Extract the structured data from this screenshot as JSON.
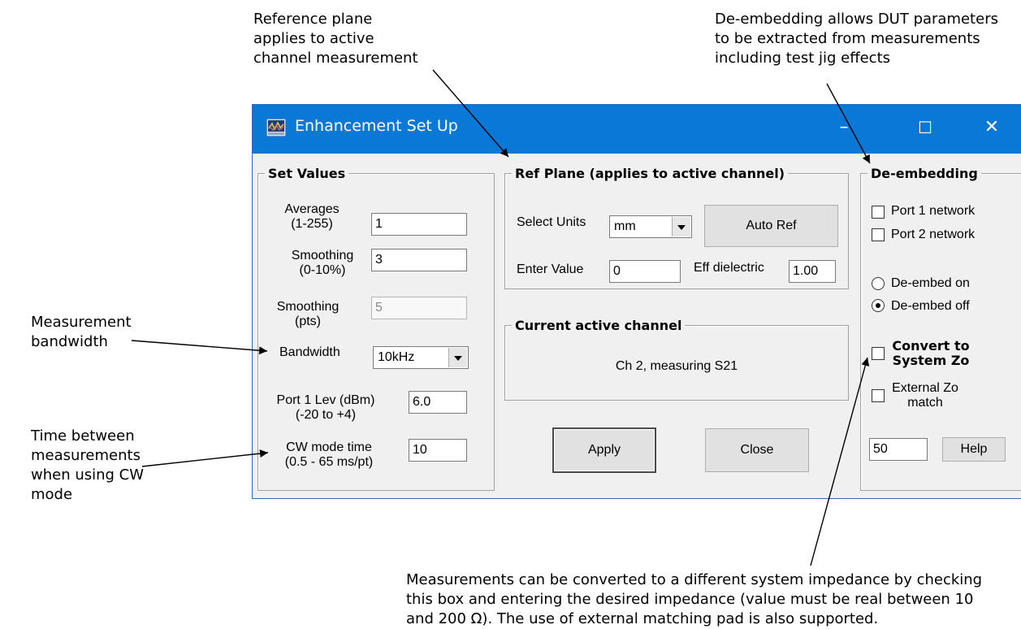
{
  "annotations": {
    "ref_plane": "Reference plane\napplies to active\nchannel measurement",
    "de_embedding": "De-embedding allows DUT parameters\nto be extracted from measurements\nincluding test jig effects",
    "bandwidth": "Measurement\nbandwidth",
    "cw_time": "Time between\nmeasurements\nwhen using CW\nmode",
    "convert": "Measurements can be converted to a different system impedance by checking\nthis box and entering the desired impedance (value must be real between 10\nand 200 Ω). The use of external matching pad is also supported."
  },
  "window": {
    "title": "Enhancement Set Up",
    "minimize": "–",
    "maximize": "☐",
    "close": "✕"
  },
  "set_values": {
    "legend": "Set Values",
    "averages_label": "Averages\n(1-255)",
    "averages_value": "1",
    "smoothing_pct_label": "Smoothing\n(0-10%)",
    "smoothing_pct_value": "3",
    "smoothing_pts_label": "Smoothing\n(pts)",
    "smoothing_pts_value": "5",
    "bandwidth_label": "Bandwidth",
    "bandwidth_value": "10kHz",
    "port1_label": "Port 1 Lev (dBm)\n(-20 to +4)",
    "port1_value": "6.0",
    "cw_label": "CW mode time\n(0.5 - 65 ms/pt)",
    "cw_value": "10"
  },
  "ref_plane": {
    "legend": "Ref Plane (applies to active channel)",
    "select_units_label": "Select Units",
    "units_value": "mm",
    "auto_ref": "Auto Ref",
    "enter_value_label": "Enter Value",
    "enter_value": "0",
    "eff_dielectric_label": "Eff dielectric",
    "eff_dielectric_value": "1.00"
  },
  "current_channel": {
    "legend": "Current active channel",
    "text": "Ch 2, measuring S21"
  },
  "buttons": {
    "apply": "Apply",
    "close": "Close",
    "help": "Help"
  },
  "de_embedding": {
    "legend": "De-embedding",
    "port1_network": "Port 1 network",
    "port2_network": "Port 2 network",
    "de_embed_on": "De-embed on",
    "de_embed_off": "De-embed off",
    "convert_label": "Convert to\nSystem Zo",
    "external_zo": "External Zo\nmatch",
    "zo_value": "50"
  },
  "colors": {
    "titlebar": "#0a78d7",
    "window_bg": "#f0f0f0"
  }
}
